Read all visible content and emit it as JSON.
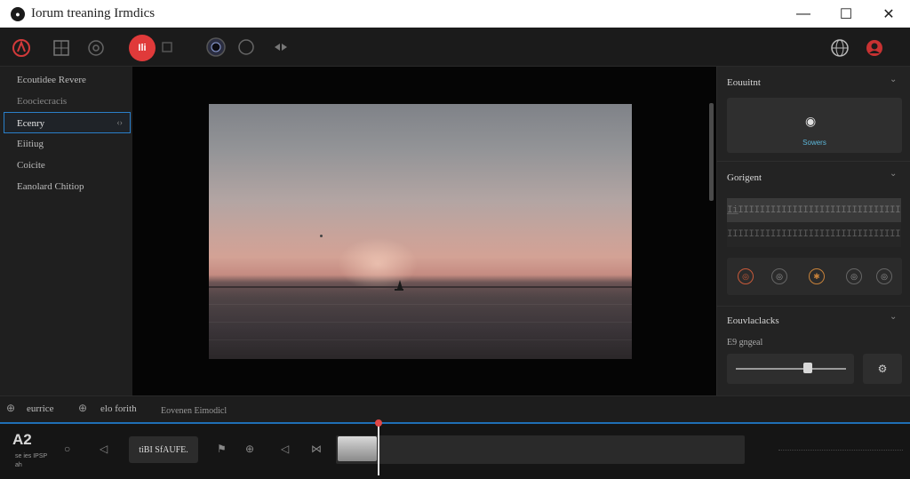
{
  "app": {
    "title": "Iorum treaning Irmdics",
    "logo_icon": "camera-lens-icon"
  },
  "window_controls": {
    "minimize": "—",
    "maximize": "☐",
    "close": "✕"
  },
  "toolbar": {
    "record_label": "Ili",
    "icons": [
      "brand-icon",
      "grid-icon",
      "settings-icon",
      "record-button",
      "stop-icon",
      "webcam-icon",
      "circle-icon",
      "transition-icon",
      "globe-icon",
      "profile-icon"
    ]
  },
  "sidebar": {
    "items": [
      {
        "label": "Ecoutidee Revere",
        "state": "normal"
      },
      {
        "label": "Eoociecracis",
        "state": "dim"
      },
      {
        "label": "Ecenry",
        "state": "selected"
      },
      {
        "label": "Eiitiug",
        "state": "normal"
      },
      {
        "label": "Coicite",
        "state": "normal"
      },
      {
        "label": "Eanolard Chitiop",
        "state": "normal"
      }
    ]
  },
  "right_panel": {
    "section1": {
      "title": "Eouuitnt",
      "source_label": "Sowers",
      "source_icon": "eye-icon"
    },
    "section2": {
      "title": "Gorigent",
      "waveform_row1": "I̲i̲IIIIIIIIIIIIIIIIIIIIIIIIIIIIII",
      "waveform_row2": "IIIIIIIIIIIIIIIIIIIIIIIIIIIIIIII",
      "fx_icons": [
        "fx-icon-1",
        "fx-icon-2",
        "fx-icon-3",
        "fx-icon-4",
        "fx-icon-5"
      ]
    },
    "section3": {
      "title": "Eouvlaclacks",
      "subtitle": "E9 gngeal",
      "slider_value": 0.72
    }
  },
  "bottom_bar": {
    "left_label": "eurrice",
    "mid_label": "elo forith",
    "right_label": "Eovenen Eimodicl"
  },
  "timeline": {
    "counter": "A2",
    "sub_lines": [
      "se ies IPSP",
      "ah"
    ],
    "button_label": "tiBI SfAUFE.",
    "playhead_position": 0.1
  },
  "colors": {
    "accent_blue": "#2a7fc9",
    "record_red": "#e03a3a",
    "source_label": "#5cb6d8"
  }
}
